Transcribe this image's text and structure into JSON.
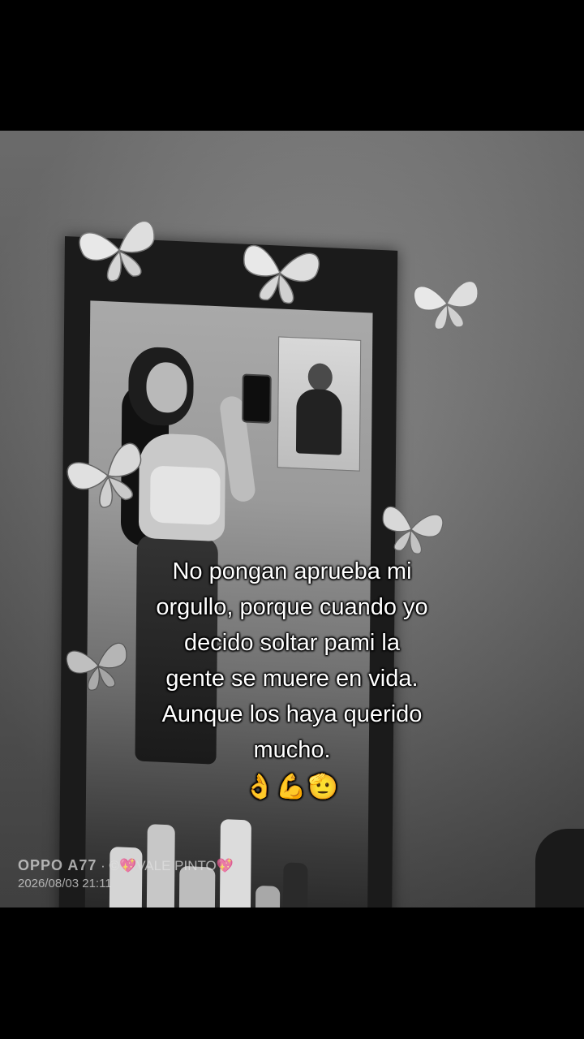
{
  "overlay": {
    "lines": [
      "No pongan aprueba mi",
      "orgullo, porque cuando yo",
      "decido soltar pami la",
      "gente se muere en vida.",
      "Aunque los haya querido",
      "mucho."
    ],
    "emojis": "👌💪🫡"
  },
  "watermark": {
    "model": "OPPO A77",
    "separator": "·",
    "author": "©💖VALE PINTO💖",
    "datetime": "2026/08/03 21:11"
  },
  "colors": {
    "background": "#000000",
    "text": "#ffffff"
  },
  "icons": [
    "butterfly-decoration"
  ]
}
